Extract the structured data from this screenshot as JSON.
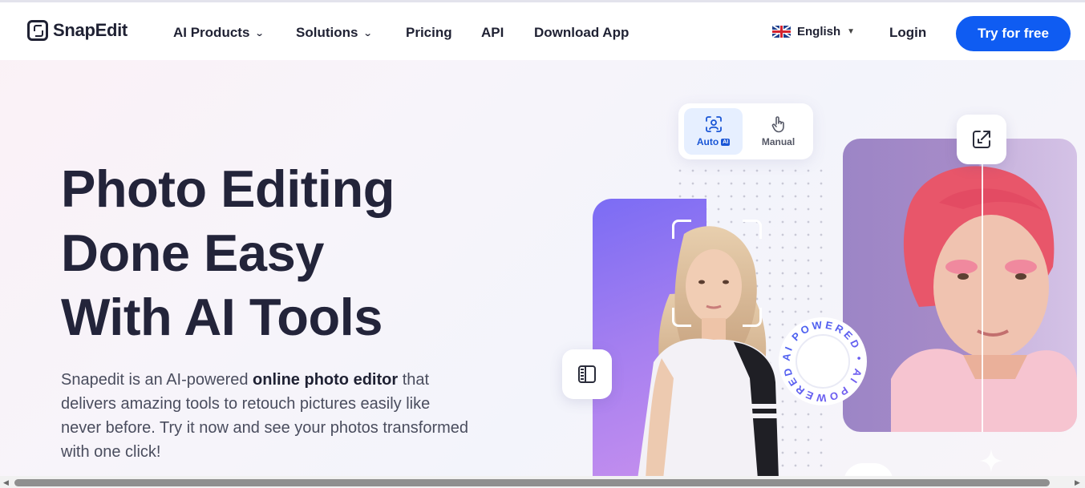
{
  "brand": {
    "name": "SnapEdit"
  },
  "nav": {
    "items": [
      {
        "label": "AI Products",
        "dropdown": true
      },
      {
        "label": "Solutions",
        "dropdown": true
      },
      {
        "label": "Pricing",
        "dropdown": false
      },
      {
        "label": "API",
        "dropdown": false
      },
      {
        "label": "Download App",
        "dropdown": false
      }
    ],
    "language": "English",
    "login": "Login",
    "cta": "Try for free"
  },
  "hero": {
    "title_lines": [
      "Photo Editing",
      "Done Easy",
      "With AI Tools"
    ],
    "desc_before": "Snapedit is an AI-powered ",
    "desc_bold": "online photo editor",
    "desc_after": " that delivers amazing tools to retouch pictures easily like never before. Try it now and see your photos transformed with one click!"
  },
  "mode_switch": {
    "auto_label": "Auto",
    "auto_chip": "AI",
    "manual_label": "Manual",
    "selected": "Auto"
  },
  "badge": {
    "text": "AI POWERED • AI POWERED •"
  },
  "colors": {
    "brand_blue": "#0f5cf2",
    "text_dark": "#23243a",
    "text_muted": "#4a4d5e",
    "auto_highlight": "#e6efff"
  },
  "icons": {
    "nav_dropdown": "chevron-down-icon",
    "language_flag": "uk-flag-icon",
    "auto_mode": "face-scan-icon",
    "manual_mode": "hand-pointer-icon",
    "expand": "expand-arrow-icon",
    "compare": "compare-split-icon"
  }
}
